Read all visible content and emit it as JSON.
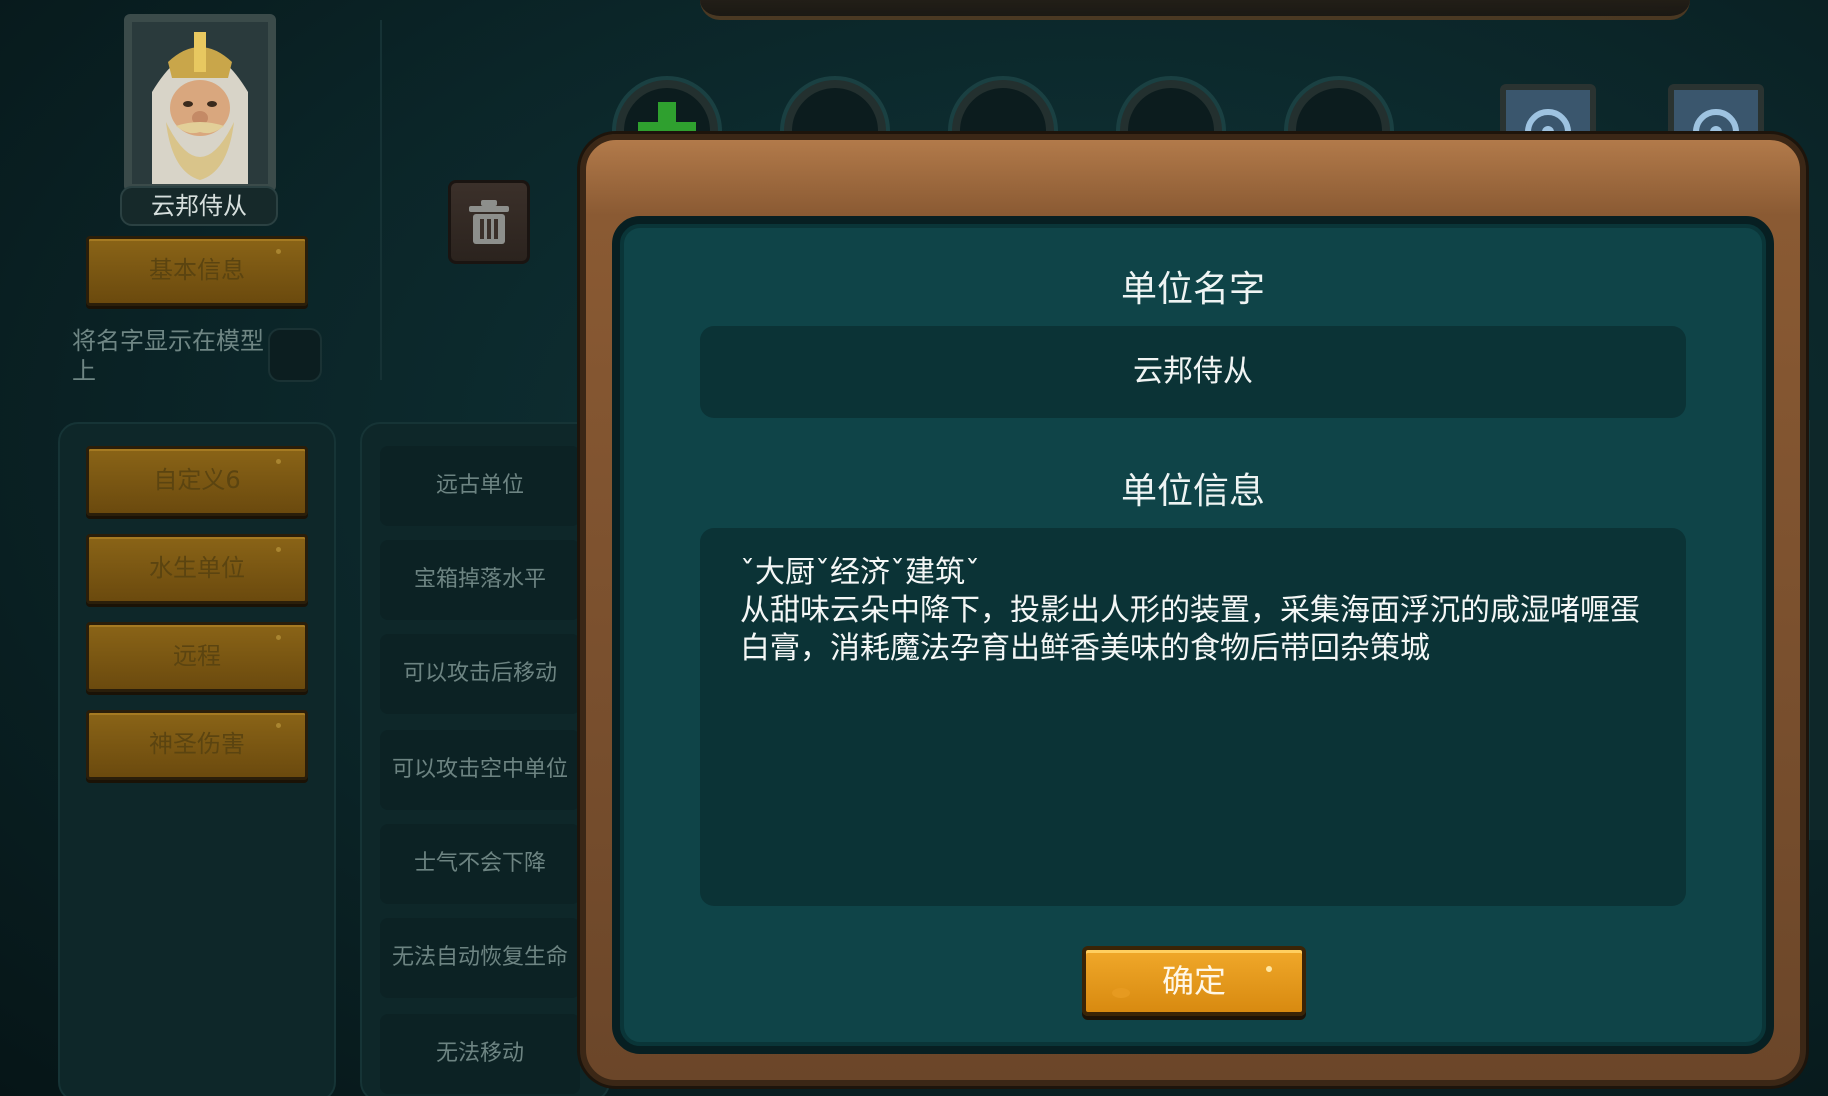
{
  "unit": {
    "name_plate": "云邦侍从"
  },
  "left_menu": {
    "basic_info": "基本信息",
    "show_name_label": "将名字显示在模型上",
    "tags": [
      "自定义6",
      "水生单位",
      "远程",
      "神圣伤害"
    ]
  },
  "attributes": [
    "远古单位",
    "宝箱掉落水平",
    "可以攻击后移动",
    "可以攻击空中单位",
    "士气不会下降",
    "无法自动恢复生命",
    "无法移动"
  ],
  "dialog": {
    "name_title": "单位名字",
    "name_value": "云邦侍从",
    "info_title": "单位信息",
    "info_text": "ˇ大厨ˇ经济ˇ建筑ˇ\n从甜味云朵中降下，投影出人形的装置，采集海面浮沉的咸湿啫喱蛋白膏，消耗魔法孕育出鲜香美味的食物后带回杂策城",
    "confirm": "确定"
  },
  "icons": {
    "trash": "trash-icon",
    "plus": "plus-icon",
    "gear": "gear-icon"
  },
  "colors": {
    "dialog_bg": "#0f4448",
    "frame_wood": "#8a5a33",
    "confirm_btn": "#e89a1c",
    "tag_btn": "#7a5714"
  }
}
